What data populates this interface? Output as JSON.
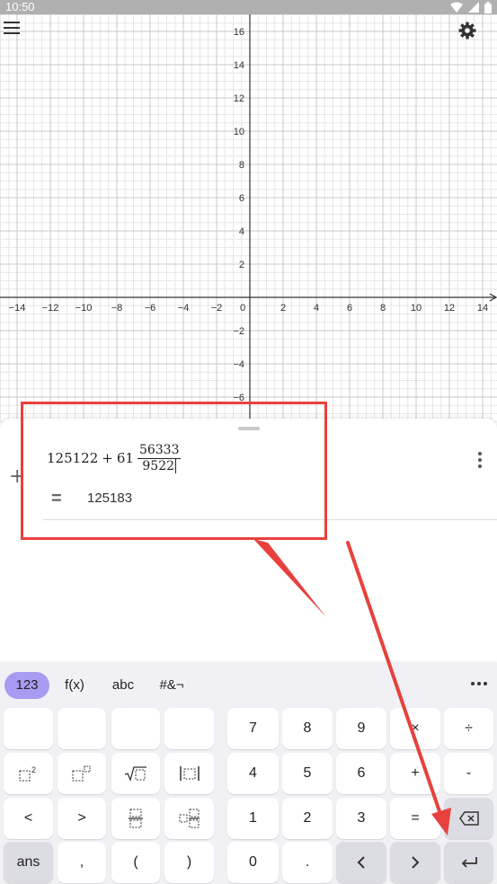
{
  "status": {
    "time": "10:50"
  },
  "graph": {
    "x_ticks": [
      "−14",
      "−12",
      "−10",
      "−8",
      "−6",
      "−4",
      "−2",
      "0",
      "2",
      "4",
      "6",
      "8",
      "10",
      "12",
      "14"
    ],
    "y_ticks_pos": [
      "16",
      "14",
      "12",
      "10",
      "8",
      "6",
      "4",
      "2"
    ],
    "y_ticks_neg": [
      "−2",
      "−4",
      "−6"
    ],
    "grid_color": "#e6e6e6",
    "major_grid_color": "#c8c8c8"
  },
  "algebra": {
    "integer_part": "125122",
    "plus": "+",
    "whole": "61",
    "numerator": "56333",
    "denominator": "9522",
    "equals": "=",
    "result": "125183"
  },
  "keyboard": {
    "tabs": [
      "123",
      "f(x)",
      "abc",
      "#&¬"
    ],
    "active_tab": "123",
    "row1_digits": [
      "7",
      "8",
      "9",
      "×",
      "÷"
    ],
    "row2_digits": [
      "4",
      "5",
      "6",
      "+",
      "-"
    ],
    "row3_left": [
      "<",
      ">"
    ],
    "row3_digits": [
      "1",
      "2",
      "3",
      "="
    ],
    "row4_left": [
      "ans",
      ",",
      "(",
      ")"
    ],
    "row4_digits": [
      "0",
      "."
    ]
  },
  "colors": {
    "accent": "#a89bf2",
    "annotation": "#e8413d"
  }
}
